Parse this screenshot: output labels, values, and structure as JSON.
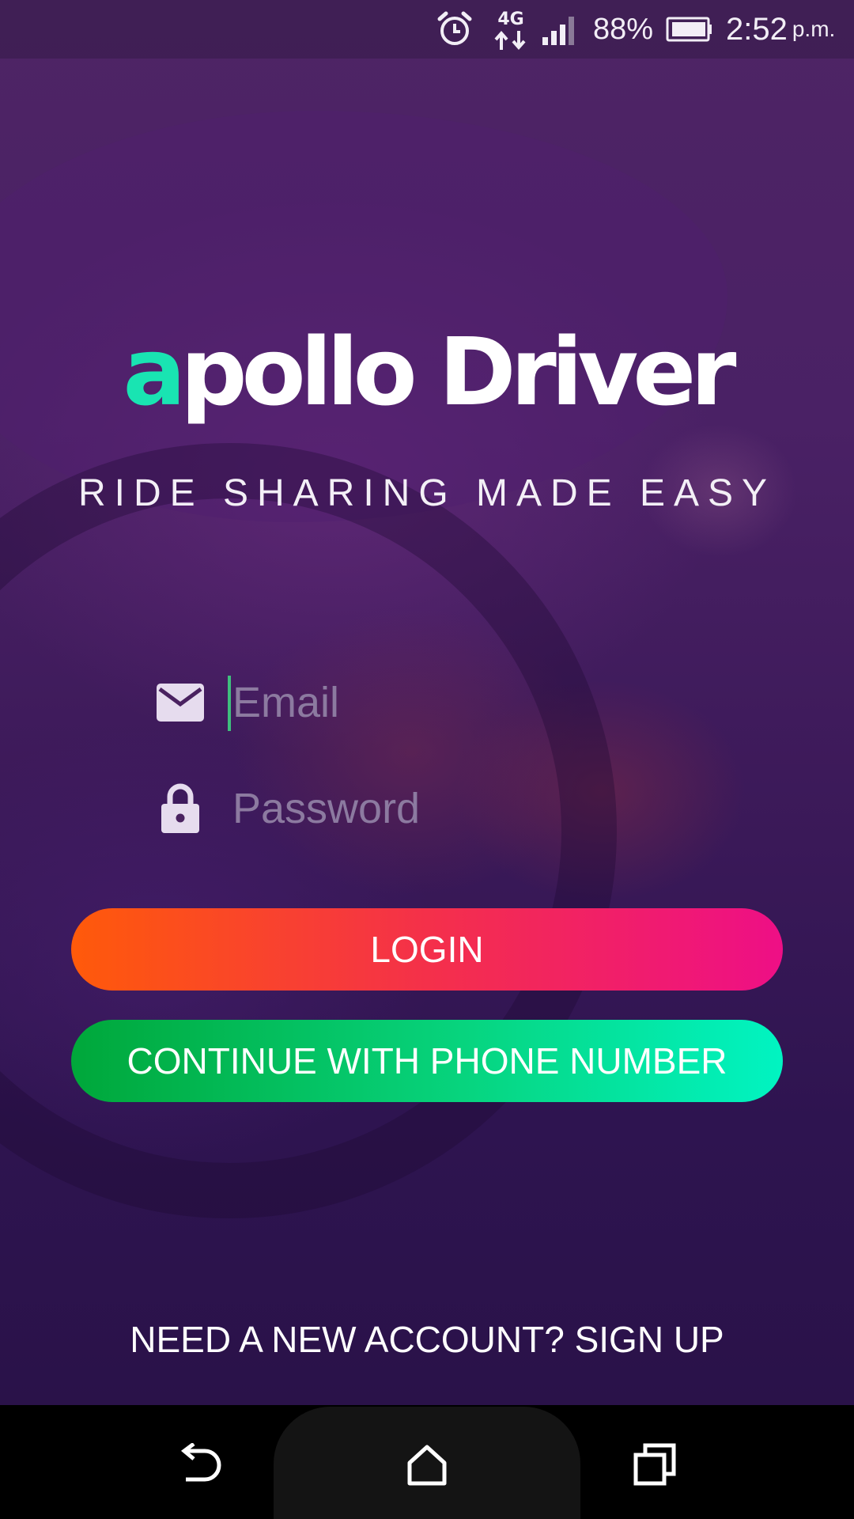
{
  "status_bar": {
    "network": "4G",
    "battery_percent": "88%",
    "time": "2:52",
    "time_suffix": "p.m.",
    "icons": [
      "alarm-icon",
      "network-4g-icon",
      "signal-icon",
      "battery-icon"
    ]
  },
  "brand": {
    "logo_accent": "a",
    "logo_rest": "pollo Driver",
    "tagline": "RIDE SHARING MADE EASY",
    "accent_color": "#19e4b2"
  },
  "form": {
    "email_placeholder": "Email",
    "email_value": "",
    "password_placeholder": "Password",
    "password_value": "",
    "email_icon": "mail-icon",
    "password_icon": "lock-icon"
  },
  "actions": {
    "login_label": "LOGIN",
    "phone_label": "CONTINUE WITH PHONE NUMBER",
    "signup_label": "NEED A NEW ACCOUNT? SIGN UP",
    "login_colors": [
      "#ff5a0a",
      "#ee0f86"
    ],
    "phone_colors": [
      "#00a73a",
      "#01f4c2"
    ]
  },
  "nav_bar": {
    "buttons": [
      "back-icon",
      "home-icon",
      "recent-apps-icon"
    ]
  }
}
